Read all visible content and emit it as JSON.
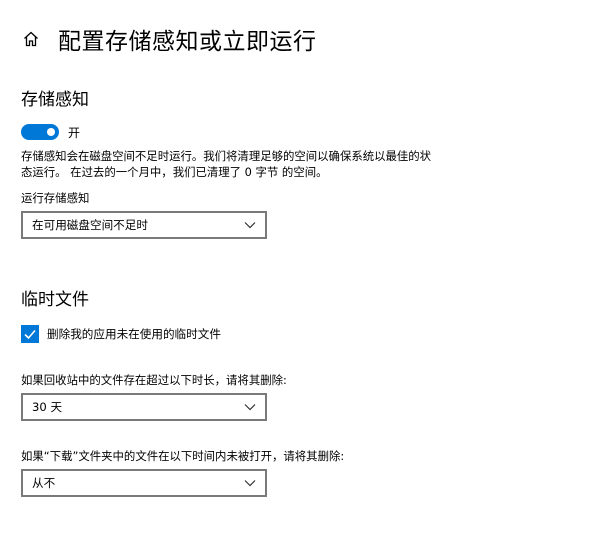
{
  "header": {
    "title": "配置存储感知或立即运行",
    "home_icon": "home-icon"
  },
  "storage_sense": {
    "section_title": "存储感知",
    "toggle_state": "on",
    "toggle_label": "开",
    "description": "存储感知会在磁盘空间不足时运行。我们将清理足够的空间以确保系统以最佳的状态运行。 在过去的一个月中，我们已清理了 0 字节 的空间。",
    "run_label": "运行存储感知",
    "run_value": "在可用磁盘空间不足时"
  },
  "temp_files": {
    "section_title": "临时文件",
    "delete_checkbox_checked": true,
    "delete_checkbox_label": "删除我的应用未在使用的临时文件",
    "recycle_label": "如果回收站中的文件存在超过以下时长，请将其删除:",
    "recycle_value": "30 天",
    "downloads_label": "如果“下载”文件夹中的文件在以下时间内未被打开，请将其删除:",
    "downloads_value": "从不"
  },
  "colors": {
    "accent": "#0078d7",
    "border": "#7a7a7a"
  }
}
